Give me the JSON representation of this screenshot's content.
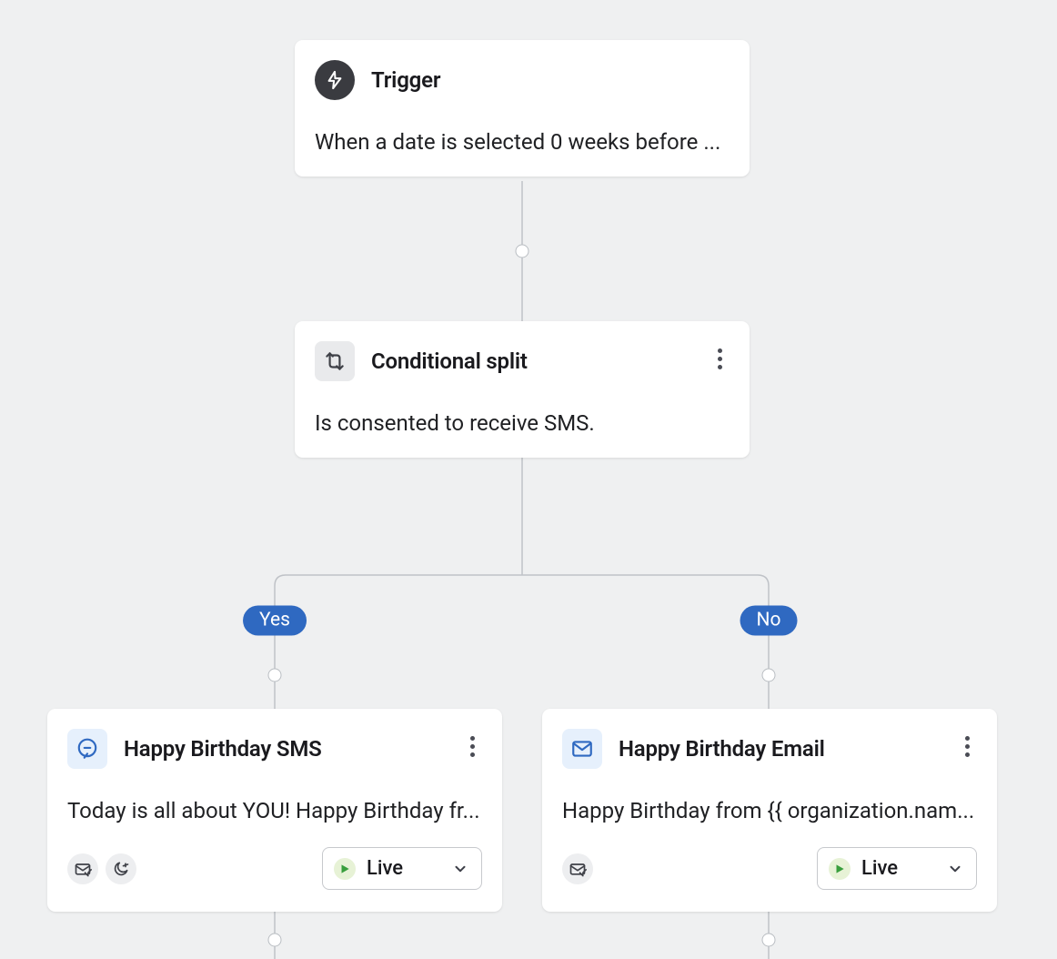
{
  "colors": {
    "badge": "#2f69c1",
    "live_green": "#389e3c",
    "icon_blue": "#2f69c1",
    "bg": "#eff0f1"
  },
  "branch_labels": {
    "yes": "Yes",
    "no": "No"
  },
  "nodes": {
    "trigger": {
      "title": "Trigger",
      "description": "When a date is selected 0 weeks before ..."
    },
    "split": {
      "title": "Conditional split",
      "description": "Is consented to receive SMS."
    },
    "sms": {
      "title": "Happy Birthday SMS",
      "description": "Today is all about YOU! Happy Birthday fr...",
      "status": "Live"
    },
    "email": {
      "title": "Happy Birthday Email",
      "description": "Happy Birthday from {{ organization.nam...",
      "status": "Live"
    }
  }
}
